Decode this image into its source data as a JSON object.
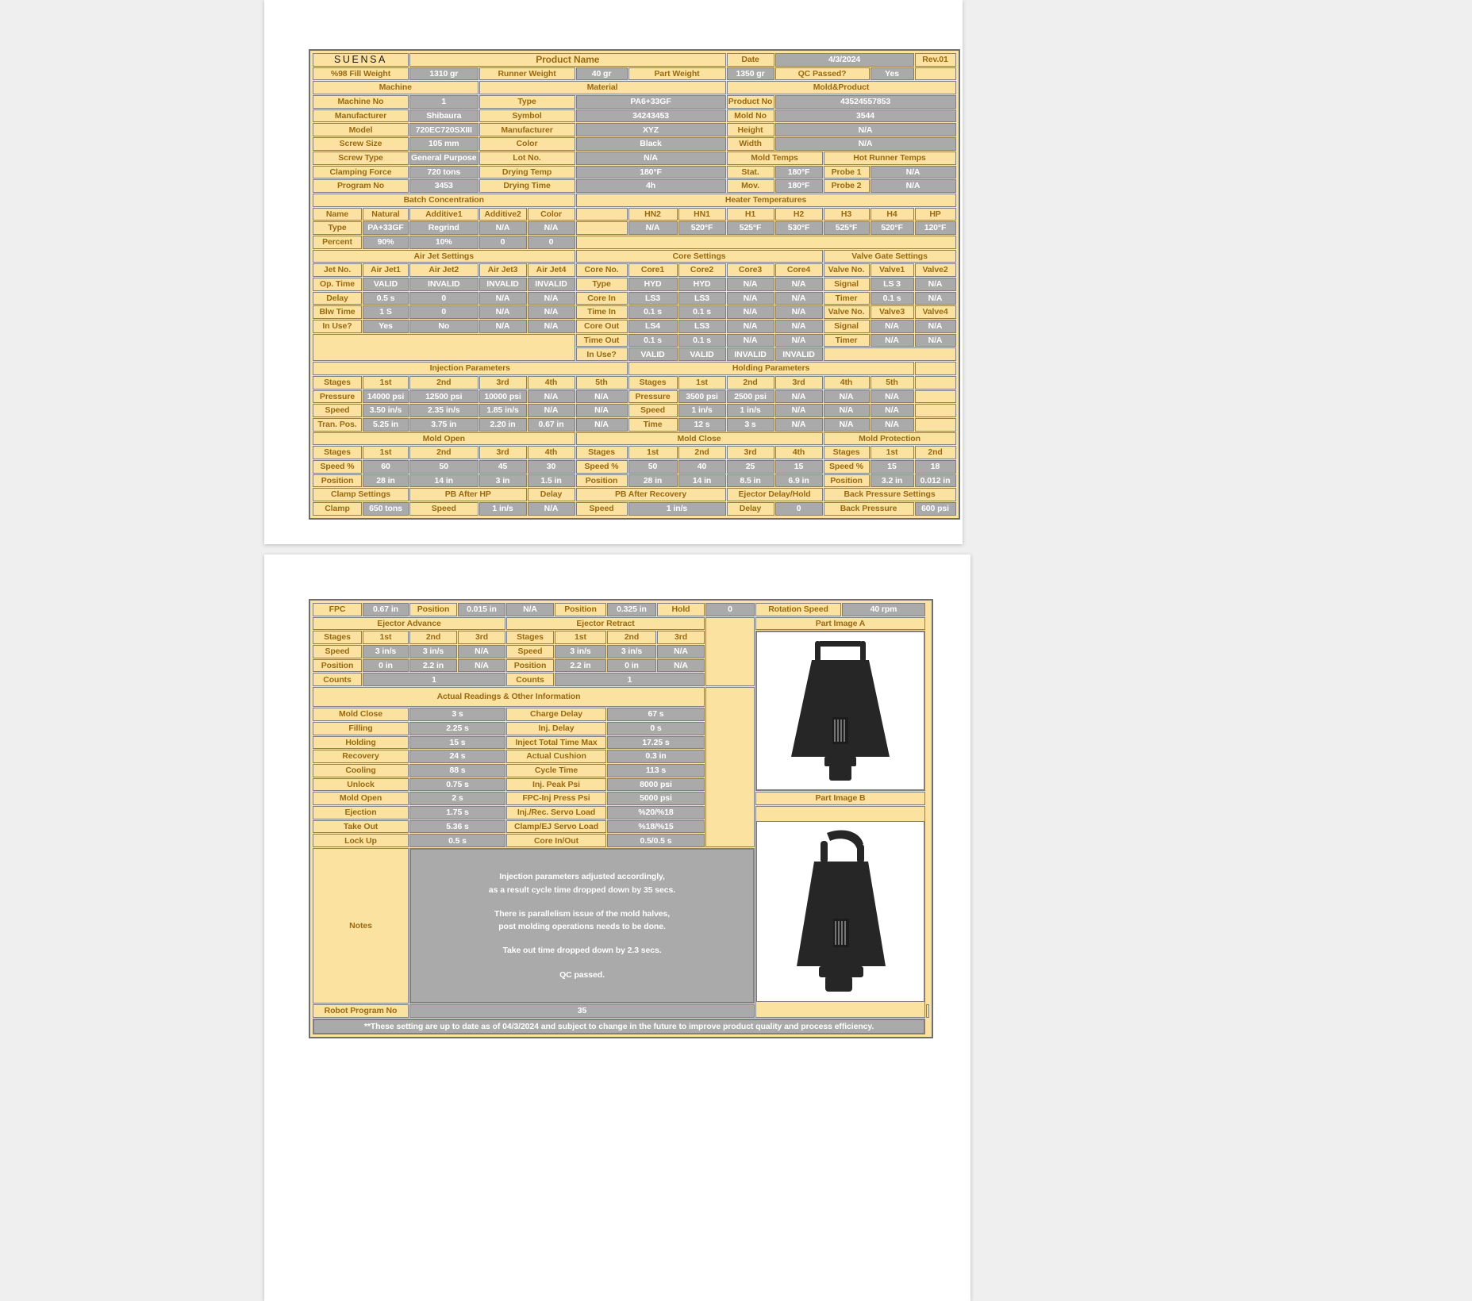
{
  "brand": {
    "logo_text": "SUENSA"
  },
  "header": {
    "product_name": "Product Name",
    "date_label": "Date",
    "date_value": "4/3/2024",
    "rev": "Rev.01",
    "fill_weight_label": "%98 Fill Weight",
    "fill_weight_value": "1310 gr",
    "runner_weight_label": "Runner Weight",
    "runner_weight_value": "40 gr",
    "part_weight_label": "Part Weight",
    "part_weight_value": "1350 gr",
    "qc_label": "QC Passed?",
    "qc_value": "Yes"
  },
  "sections": {
    "machine": "Machine",
    "material": "Material",
    "mold_product": "Mold&Product",
    "batch_concentration": "Batch Concentration",
    "heater_temperatures": "Heater Temperatures",
    "air_jet_settings": "Air Jet Settings",
    "core_settings": "Core Settings",
    "valve_gate_settings": "Valve Gate Settings",
    "injection_parameters": "Injection Parameters",
    "holding_parameters": "Holding Parameters",
    "mold_open": "Mold Open",
    "mold_close": "Mold Close",
    "mold_protection": "Mold Protection",
    "mold_temps": "Mold Temps",
    "hot_runner_temps": "Hot Runner Temps",
    "ejector_advance": "Ejector Advance",
    "ejector_retract": "Ejector Retract",
    "actual_readings": "Actual  Readings & Other Information",
    "part_image_a": "Part Image A",
    "part_image_b": "Part Image B"
  },
  "machine": [
    {
      "label": "Machine No",
      "value": "1"
    },
    {
      "label": "Manufacturer",
      "value": "Shibaura"
    },
    {
      "label": "Model",
      "value": "720EC720SXIII"
    },
    {
      "label": "Screw Size",
      "value": "105 mm"
    },
    {
      "label": "Screw Type",
      "value": "General Purpose"
    },
    {
      "label": "Clamping Force",
      "value": "720 tons"
    },
    {
      "label": "Program No",
      "value": "3453"
    }
  ],
  "material": [
    {
      "label": "Type",
      "value": "PA6+33GF"
    },
    {
      "label": "Symbol",
      "value": "34243453"
    },
    {
      "label": "Manufacturer",
      "value": "XYZ"
    },
    {
      "label": "Color",
      "value": "Black"
    },
    {
      "label": "Lot No.",
      "value": "N/A"
    },
    {
      "label": "Drying Temp",
      "value": "180°F"
    },
    {
      "label": "Drying Time",
      "value": "4h"
    }
  ],
  "mold_product": [
    {
      "label": "Product No",
      "value": "43524557853"
    },
    {
      "label": "Mold No",
      "value": "3544"
    },
    {
      "label": "Height",
      "value": "N/A"
    },
    {
      "label": "Width",
      "value": "N/A"
    }
  ],
  "mold_temps": [
    {
      "label": "Stat.",
      "value": "180°F"
    },
    {
      "label": "Mov.",
      "value": "180°F"
    }
  ],
  "hot_runner_temps": [
    {
      "label": "Probe 1",
      "value": "N/A"
    },
    {
      "label": "Probe 2",
      "value": "N/A"
    }
  ],
  "batch": {
    "row_labels": [
      "Name",
      "Type",
      "Percent"
    ],
    "columns": [
      "Natural",
      "Additive1",
      "Additive2",
      "Color"
    ],
    "types": [
      "PA+33GF",
      "Regrind",
      "N/A",
      "N/A"
    ],
    "percents": [
      "90%",
      "10%",
      "0",
      "0"
    ]
  },
  "heater": {
    "zones": [
      "HN2",
      "HN1",
      "H1",
      "H2",
      "H3",
      "H4",
      "HP"
    ],
    "values": [
      "N/A",
      "520°F",
      "525°F",
      "530°F",
      "525°F",
      "520°F",
      "120°F"
    ]
  },
  "air_jet": {
    "row_labels": [
      "Jet No.",
      "Op. Time",
      "Delay",
      "Blw Time",
      "In Use?"
    ],
    "columns": [
      "Air Jet1",
      "Air Jet2",
      "Air Jet3",
      "Air Jet4"
    ],
    "op_time": [
      "VALID",
      "INVALID",
      "INVALID",
      "INVALID"
    ],
    "delay": [
      "0.5 s",
      "0",
      "N/A",
      "N/A"
    ],
    "blw_time": [
      "1 S",
      "0",
      "N/A",
      "N/A"
    ],
    "in_use": [
      "Yes",
      "No",
      "N/A",
      "N/A"
    ]
  },
  "core": {
    "row_labels": [
      "Core No.",
      "Type",
      "Core In",
      "Time In",
      "Core Out",
      "Time Out",
      "In Use?"
    ],
    "columns": [
      "Core1",
      "Core2",
      "Core3",
      "Core4"
    ],
    "type": [
      "HYD",
      "HYD",
      "N/A",
      "N/A"
    ],
    "core_in": [
      "LS3",
      "LS3",
      "N/A",
      "N/A"
    ],
    "time_in": [
      "0.1 s",
      "0.1 s",
      "N/A",
      "N/A"
    ],
    "core_out": [
      "LS4",
      "LS3",
      "N/A",
      "N/A"
    ],
    "time_out": [
      "0.1 s",
      "0.1 s",
      "N/A",
      "N/A"
    ],
    "in_use": [
      "VALID",
      "VALID",
      "INVALID",
      "INVALID"
    ]
  },
  "valve_gate": {
    "row1_label": "Valve No.",
    "row1_cols": [
      "Valve1",
      "Valve2"
    ],
    "signal_label": "Signal",
    "signal_vals": [
      "LS 3",
      "N/A"
    ],
    "timer_label": "Timer",
    "timer_vals": [
      "0.1 s",
      "N/A"
    ],
    "row2_label": "Valve No.",
    "row2_cols": [
      "Valve3",
      "Valve4"
    ],
    "signal2_vals": [
      "N/A",
      "N/A"
    ],
    "timer2_vals": [
      "N/A",
      "N/A"
    ]
  },
  "injection": {
    "row_labels": [
      "Stages",
      "Pressure",
      "Speed",
      "Tran. Pos."
    ],
    "stages": [
      "1st",
      "2nd",
      "3rd",
      "4th",
      "5th"
    ],
    "pressure": [
      "14000 psi",
      "12500 psi",
      "10000 psi",
      "N/A",
      "N/A"
    ],
    "speed": [
      "3.50 in/s",
      "2.35 in/s",
      "1.85 in/s",
      "N/A",
      "N/A"
    ],
    "tran_pos": [
      "5.25 in",
      "3.75 in",
      "2.20 in",
      "0.67 in",
      "N/A"
    ]
  },
  "holding": {
    "row_labels": [
      "Stages",
      "Pressure",
      "Speed",
      "Time"
    ],
    "stages": [
      "1st",
      "2nd",
      "3rd",
      "4th",
      "5th"
    ],
    "pressure": [
      "3500 psi",
      "2500 psi",
      "N/A",
      "N/A",
      "N/A"
    ],
    "speed": [
      "1 in/s",
      "1 in/s",
      "N/A",
      "N/A",
      "N/A"
    ],
    "time": [
      "12 s",
      "3 s",
      "N/A",
      "N/A",
      "N/A"
    ]
  },
  "mold_open": {
    "row_labels": [
      "Stages",
      "Speed %",
      "Position"
    ],
    "stages": [
      "1st",
      "2nd",
      "3rd",
      "4th"
    ],
    "speed": [
      "60",
      "50",
      "45",
      "30"
    ],
    "position": [
      "28 in",
      "14 in",
      "3 in",
      "1.5 in"
    ]
  },
  "mold_close": {
    "row_labels": [
      "Stages",
      "Speed %",
      "Position"
    ],
    "stages": [
      "1st",
      "2nd",
      "3rd",
      "4th"
    ],
    "speed": [
      "50",
      "40",
      "25",
      "15"
    ],
    "position": [
      "28 in",
      "14 in",
      "8.5 in",
      "6.9 in"
    ]
  },
  "mold_protection": {
    "row_labels": [
      "Stages",
      "Speed %",
      "Position"
    ],
    "stages": [
      "1st",
      "2nd"
    ],
    "speed": [
      "15",
      "18"
    ],
    "position": [
      "3.2 in",
      "0.012 in"
    ]
  },
  "clamp_row": {
    "clamp_settings": "Clamp Settings",
    "pb_after_hp": "PB After HP",
    "delay_hdr": "Delay",
    "pb_after_recovery": "PB After Recovery",
    "ejector_delay_hold": "Ejector Delay/Hold",
    "back_pressure_settings": "Back Pressure Settings",
    "clamp_label": "Clamp",
    "clamp_value": "650 tons",
    "speed_label_1": "Speed",
    "speed_value_1": "1 in/s",
    "delay_value_1": "N/A",
    "speed_label_2": "Speed",
    "speed_value_2": "1 in/s",
    "delay_label": "Delay",
    "delay_value_2": "0",
    "back_pressure_label": "Back Pressure",
    "back_pressure_value": "600 psi"
  },
  "fpc_row": {
    "fpc_label": "FPC",
    "fpc_value": "0.67 in",
    "position_label_1": "Position",
    "position_value_1": "0.015 in",
    "na": "N/A",
    "position_label_2": "Position",
    "position_value_2": "0.325 in",
    "hold_label": "Hold",
    "hold_value": "0",
    "rotation_speed_label": "Rotation Speed",
    "rotation_speed_value": "40 rpm"
  },
  "ejector_advance": {
    "row_labels": [
      "Stages",
      "Speed",
      "Position",
      "Counts"
    ],
    "stages": [
      "1st",
      "2nd",
      "3rd"
    ],
    "speed": [
      "3 in/s",
      "3 in/s",
      "N/A"
    ],
    "position": [
      "0 in",
      "2.2 in",
      "N/A"
    ],
    "counts": "1"
  },
  "ejector_retract": {
    "row_labels": [
      "Stages",
      "Speed",
      "Position",
      "Counts"
    ],
    "stages": [
      "1st",
      "2nd",
      "3rd"
    ],
    "speed": [
      "3 in/s",
      "3 in/s",
      "N/A"
    ],
    "position": [
      "2.2 in",
      "0 in",
      "N/A"
    ],
    "counts": "1"
  },
  "actual_readings": {
    "left": [
      {
        "label": "Mold Close",
        "value": "3 s"
      },
      {
        "label": "Filling",
        "value": "2.25 s"
      },
      {
        "label": "Holding",
        "value": "15 s"
      },
      {
        "label": "Recovery",
        "value": "24 s"
      },
      {
        "label": "Cooling",
        "value": "88 s"
      },
      {
        "label": "Unlock",
        "value": "0.75 s"
      },
      {
        "label": "Mold Open",
        "value": "2 s"
      },
      {
        "label": "Ejection",
        "value": "1.75 s"
      },
      {
        "label": "Take Out",
        "value": "5.36 s"
      },
      {
        "label": "Lock Up",
        "value": "0.5 s"
      }
    ],
    "right": [
      {
        "label": "Charge Delay",
        "value": "67 s"
      },
      {
        "label": "Inj. Delay",
        "value": "0 s"
      },
      {
        "label": "Inject Total Time Max",
        "value": "17.25 s"
      },
      {
        "label": "Actual Cushion",
        "value": "0.3 in"
      },
      {
        "label": "Cycle Time",
        "value": "113 s"
      },
      {
        "label": "Inj. Peak Psi",
        "value": "8000 psi"
      },
      {
        "label": "FPC-Inj Press Psi",
        "value": "5000 psi"
      },
      {
        "label": "Inj./Rec. Servo Load",
        "value": "%20/%18"
      },
      {
        "label": "Clamp/EJ Servo Load",
        "value": "%18/%15"
      },
      {
        "label": "Core In/Out",
        "value": "0.5/0.5 s"
      }
    ]
  },
  "notes": {
    "label": "Notes",
    "lines": [
      "Injection parameters adjusted accordingly,",
      "as a result cycle time dropped down by 35 secs.",
      "",
      "There is parallelism issue of the mold halves,",
      "post molding operations needs to be done.",
      "",
      "Take out time dropped down by 2.3 secs.",
      "",
      "QC passed."
    ]
  },
  "robot": {
    "label": "Robot Program No",
    "value": "35"
  },
  "footer": {
    "text": "**These setting are up to date as of 04/3/2024 and subject to change in the future to improve product quality and process efficiency."
  },
  "colors": {
    "label_bg": "#fbe2a0",
    "label_fg": "#9a6a13",
    "value_bg": "#aaaaaa",
    "value_fg": "#ffffff",
    "border": "#7f7f7f"
  }
}
